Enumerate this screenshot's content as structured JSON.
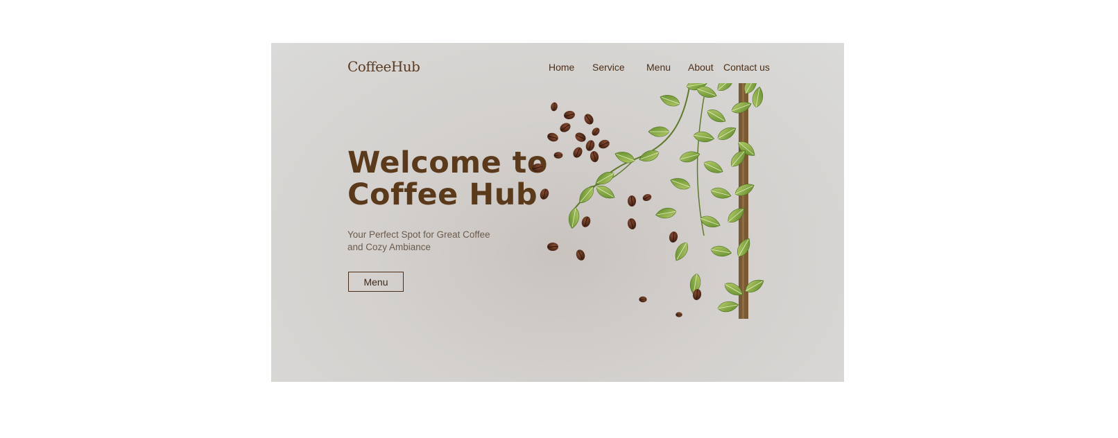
{
  "brand": {
    "name": "CoffeeHub"
  },
  "nav": {
    "items": [
      "Home",
      "Service",
      "Menu",
      "About",
      "Contact us"
    ]
  },
  "hero": {
    "title_line1": "Welcome to",
    "title_line2": "Coffee Hub",
    "subtitle_line1": "Your Perfect Spot for Great Coffee",
    "subtitle_line2": "and Cozy Ambiance",
    "button_label": "Menu"
  },
  "colors": {
    "brand_brown": "#5b3a1c",
    "nav_text": "#4b2e17",
    "subtitle_text": "#6c5a4b",
    "background": "#d8d6d3",
    "leaf_green": "#8fae4a",
    "bean": "#5a2e1b"
  },
  "image": {
    "icon": "coffee-beans-and-vine-illustration"
  }
}
